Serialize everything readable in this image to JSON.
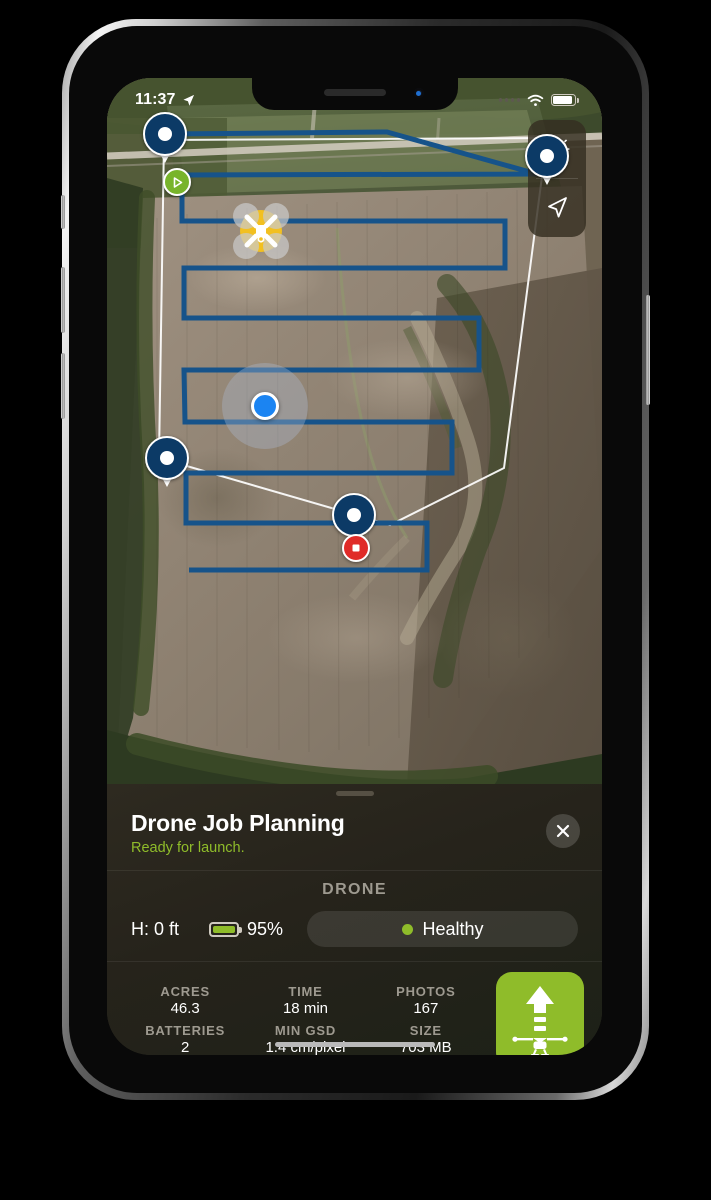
{
  "status_bar": {
    "time": "11:37",
    "location_icon": "location-arrow-icon",
    "wifi_icon": "wifi-icon",
    "battery_icon": "battery-full-icon",
    "signal_icon": "signal-dots-icon"
  },
  "map": {
    "controls": [
      {
        "name": "compass-gear-icon",
        "label": "Map settings"
      },
      {
        "name": "navigation-arrow-icon",
        "label": "Center on location"
      }
    ],
    "markers": {
      "start_icon": "play-icon",
      "stop_icon": "stop-icon",
      "drone_icon": "drone-icon",
      "user_location_icon": "user-location-dot"
    },
    "waypoint_count": 4,
    "flight_path_color": "#16538a",
    "boundary_color": "#ffffff"
  },
  "sheet": {
    "title": "Drone Job Planning",
    "subtitle": "Ready for launch.",
    "subtitle_color": "#8fbc2a",
    "close_icon": "close-icon",
    "grabber": "drag-handle",
    "section_label": "DRONE",
    "drone": {
      "altitude": "H: 0 ft",
      "battery_percent": "95%",
      "battery_icon": "battery-icon",
      "health_status": "Healthy",
      "health_color": "#8fbc2a"
    },
    "stats": [
      {
        "key": "ACRES",
        "value": "46.3"
      },
      {
        "key": "TIME",
        "value": "18 min"
      },
      {
        "key": "PHOTOS",
        "value": "167"
      },
      {
        "key": "BATTERIES",
        "value": "2"
      },
      {
        "key": "MIN GSD",
        "value": "1.4 cm/pixel"
      },
      {
        "key": "SIZE",
        "value": "703 MB"
      }
    ],
    "launch_button": {
      "icon": "launch-drone-icon",
      "color": "#8fbc2a"
    }
  }
}
